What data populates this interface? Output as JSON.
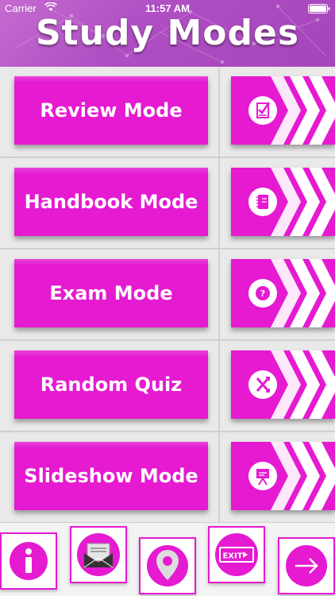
{
  "status_bar": {
    "carrier": "Carrier",
    "time": "11:57 AM"
  },
  "header": {
    "title": "Study Modes"
  },
  "modes": [
    {
      "label": "Review Mode",
      "icon": "checklist-icon"
    },
    {
      "label": "Handbook Mode",
      "icon": "notebook-icon"
    },
    {
      "label": "Exam Mode",
      "icon": "question-icon"
    },
    {
      "label": "Random Quiz",
      "icon": "shuffle-icon"
    },
    {
      "label": "Slideshow Mode",
      "icon": "presentation-icon"
    }
  ],
  "toolbar": {
    "items": [
      "info-icon",
      "email-icon",
      "location-icon",
      "exit-icon",
      "next-arrow-icon"
    ],
    "exit_label": "EXIT"
  },
  "colors": {
    "accent": "#e51ad1",
    "header": "#b04fc4",
    "background": "#e9e9e9"
  }
}
